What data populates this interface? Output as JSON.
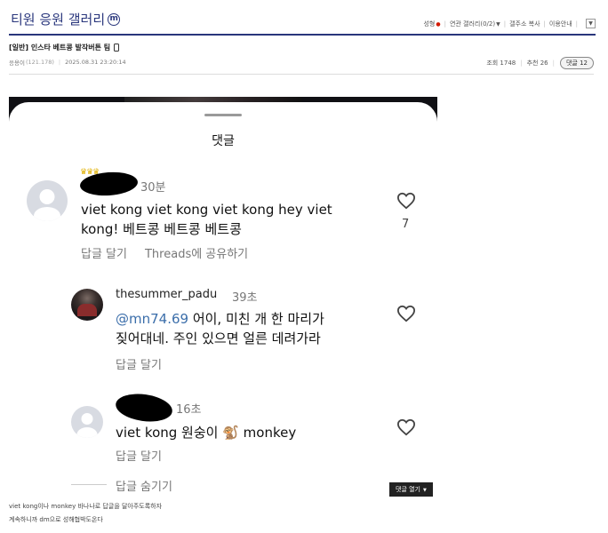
{
  "gallery": {
    "title": "티원 응원 갤러리",
    "minor_badge": "m",
    "menu": {
      "new_label": "성형",
      "related_label": "연관 갤러리(0/2)",
      "bookmark_label": "갤주소 복사",
      "guide_label": "이용안내",
      "dropdown_glyph": "▼"
    }
  },
  "post": {
    "title": "[일반] 인스타 베트콩 발작버튼 팀",
    "author": "응용이",
    "author_ip": "(121.178)",
    "datetime": "2025.08.31 23:20:14",
    "views_label": "조회 1748",
    "recommend_label": "추천 26",
    "comment_button": "댓글 12"
  },
  "screenshot": {
    "sheet_title": "댓글",
    "comments": [
      {
        "time": "30분",
        "text_line1": "viet kong viet kong viet kong hey viet",
        "text_line2": "kong! 베트콩 베트콩 베트콩",
        "likes": "7",
        "reply_action": "답글 달기",
        "share_action": "Threads에 공유하기",
        "crown_glyph": "♛♛♛"
      },
      {
        "username": "thesummer_padu",
        "time": "39초",
        "mention": "@mn74.69",
        "text_line1_rest": " 어이, 미친 개 한 마리가",
        "text_line2": "짖어대네. 주인 있으면 얼른 데려가라",
        "reply_action": "답글 달기"
      },
      {
        "time": "16초",
        "text": "viet kong 원숭이 🐒 monkey",
        "reply_action": "답글 달기"
      }
    ],
    "hide_replies": "답글 숨기기"
  },
  "comments_open_button": "댓글 열기",
  "body_lines": [
    "viet kong이나 monkey 바나나로 답글을 달아주도록하자",
    "계속하니까 dm으로 성해협박도온다"
  ],
  "colors": {
    "brand": "#29367c",
    "mention": "#3b6eaa"
  }
}
